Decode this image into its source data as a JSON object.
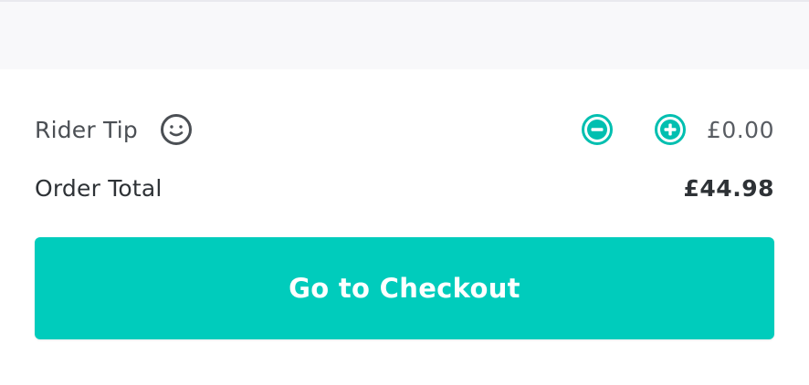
{
  "tip": {
    "label": "Rider Tip",
    "amount": "£0.00",
    "face_icon": "smiley-face-icon",
    "decrease_icon": "minus-circle-icon",
    "increase_icon": "plus-circle-icon"
  },
  "total": {
    "label": "Order Total",
    "amount": "£44.98"
  },
  "checkout": {
    "label": "Go to Checkout"
  },
  "colors": {
    "accent": "#00ccbc",
    "text": "#2e3236",
    "muted_text": "#585c62",
    "icon_gray": "#4b4f54",
    "top_band": "#f8f8fa"
  }
}
